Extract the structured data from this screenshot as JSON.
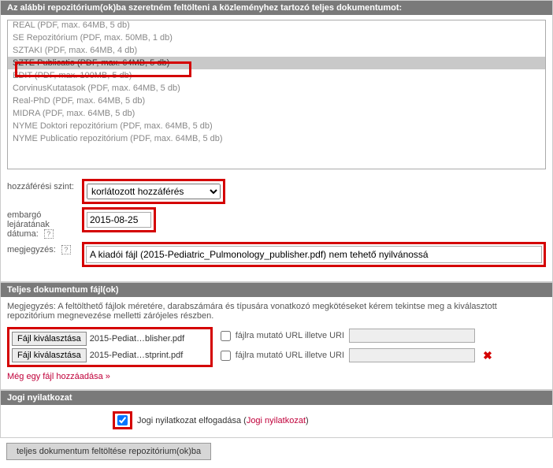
{
  "top_header": "Az alábbi repozitórium(ok)ba szeretném feltölteni a közleményhez tartozó teljes dokumentumot:",
  "repos": [
    "REAL (PDF, max. 64MB, 5 db)",
    "SE Repozitórium (PDF, max. 50MB, 1 db)",
    "SZTAKI (PDF, max. 64MB, 4 db)",
    "SZTE Publicatio (PDF, max. 64MB, 5 db)",
    "EDIT (PDF, max. 100MB, 5 db)",
    "CorvinusKutatasok (PDF, max. 64MB, 5 db)",
    "Real-PhD (PDF, max. 64MB, 5 db)",
    "MIDRA (PDF, max. 64MB, 5 db)",
    "NYME Doktori repozitórium (PDF, max. 64MB, 5 db)",
    "NYME Publicatio repozitórium (PDF, max. 64MB, 5 db)"
  ],
  "selected_repo_index": 3,
  "labels": {
    "access": "hozzáférési szint:",
    "embargo": "embargó lejáratának dátuma:",
    "note": "megjegyzés:",
    "help": "?"
  },
  "access": {
    "value": "korlátozott hozzáférés",
    "options": [
      "korlátozott hozzáférés"
    ]
  },
  "embargo_date": "2015-08-25",
  "note_value": "A kiadói fájl (2015-Pediatric_Pulmonology_publisher.pdf) nem tehető nyilvánossá",
  "doc_header": "Teljes dokumentum fájl(ok)",
  "doc_note": "Megjegyzés: A feltölthető fájlok méretére, darabszámára és típusára vonatkozó megkötéseket kérem tekintse meg a kiválasztott repozitórium megnevezése melletti zárójeles részben.",
  "file_btn": "Fájl kiválasztása",
  "files": [
    "2015-Pediat…blisher.pdf",
    "2015-Pediat…stprint.pdf"
  ],
  "url_label": "fájlra mutató URL illetve URI",
  "add_file": "Még egy fájl hozzáadása »",
  "legal_header": "Jogi nyilatkozat",
  "legal_text": "Jogi nyilatkozat elfogadása (",
  "legal_link": "Jogi nyilatkozat",
  "legal_close": ")",
  "legal_checked": true,
  "submit": "teljes dokumentum feltöltése repozitórium(ok)ba",
  "delete_icon": "✖"
}
